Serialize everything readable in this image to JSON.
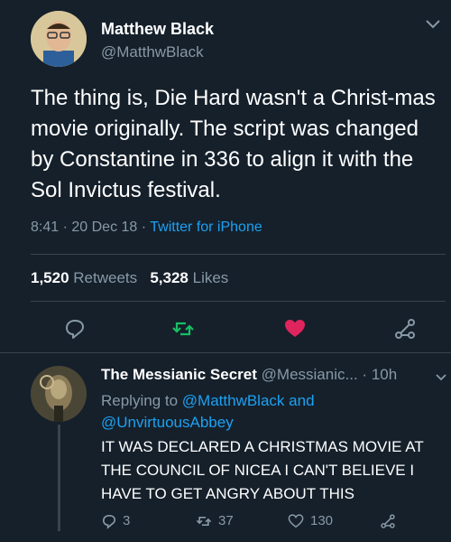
{
  "main_tweet": {
    "display_name": "Matthew Black",
    "handle": "@MatthwBlack",
    "text": "The thing is, Die Hard wasn't a Christ-mas movie originally. The script was changed by Constantine in 336 to align it with the Sol Invictus festival.",
    "time": "8:41",
    "date": "20 Dec 18",
    "source": "Twitter for iPhone",
    "retweet_count": "1,520",
    "retweet_label": "Retweets",
    "like_count": "5,328",
    "like_label": "Likes",
    "icons": [
      "reply-icon",
      "retweet-icon",
      "heart-icon",
      "share-icon"
    ],
    "colors": {
      "retweet": "#17bf63",
      "like": "#e0245e",
      "link": "#1da1f2"
    }
  },
  "reply": {
    "display_name": "The Messianic Secret",
    "handle": "@Messianic...",
    "time": "10h",
    "replying_prefix": "Replying to",
    "mention_1": "@MatthwBlack",
    "and": "and",
    "mention_2": "@UnvirtuousAbbey",
    "text": "IT WAS DECLARED A CHRISTMAS MOVIE AT THE COUNCIL OF NICEA I CAN'T BELIEVE I HAVE TO GET ANGRY ABOUT THIS",
    "reply_count": "3",
    "retweet_count": "37",
    "like_count": "130"
  },
  "separator": "·"
}
